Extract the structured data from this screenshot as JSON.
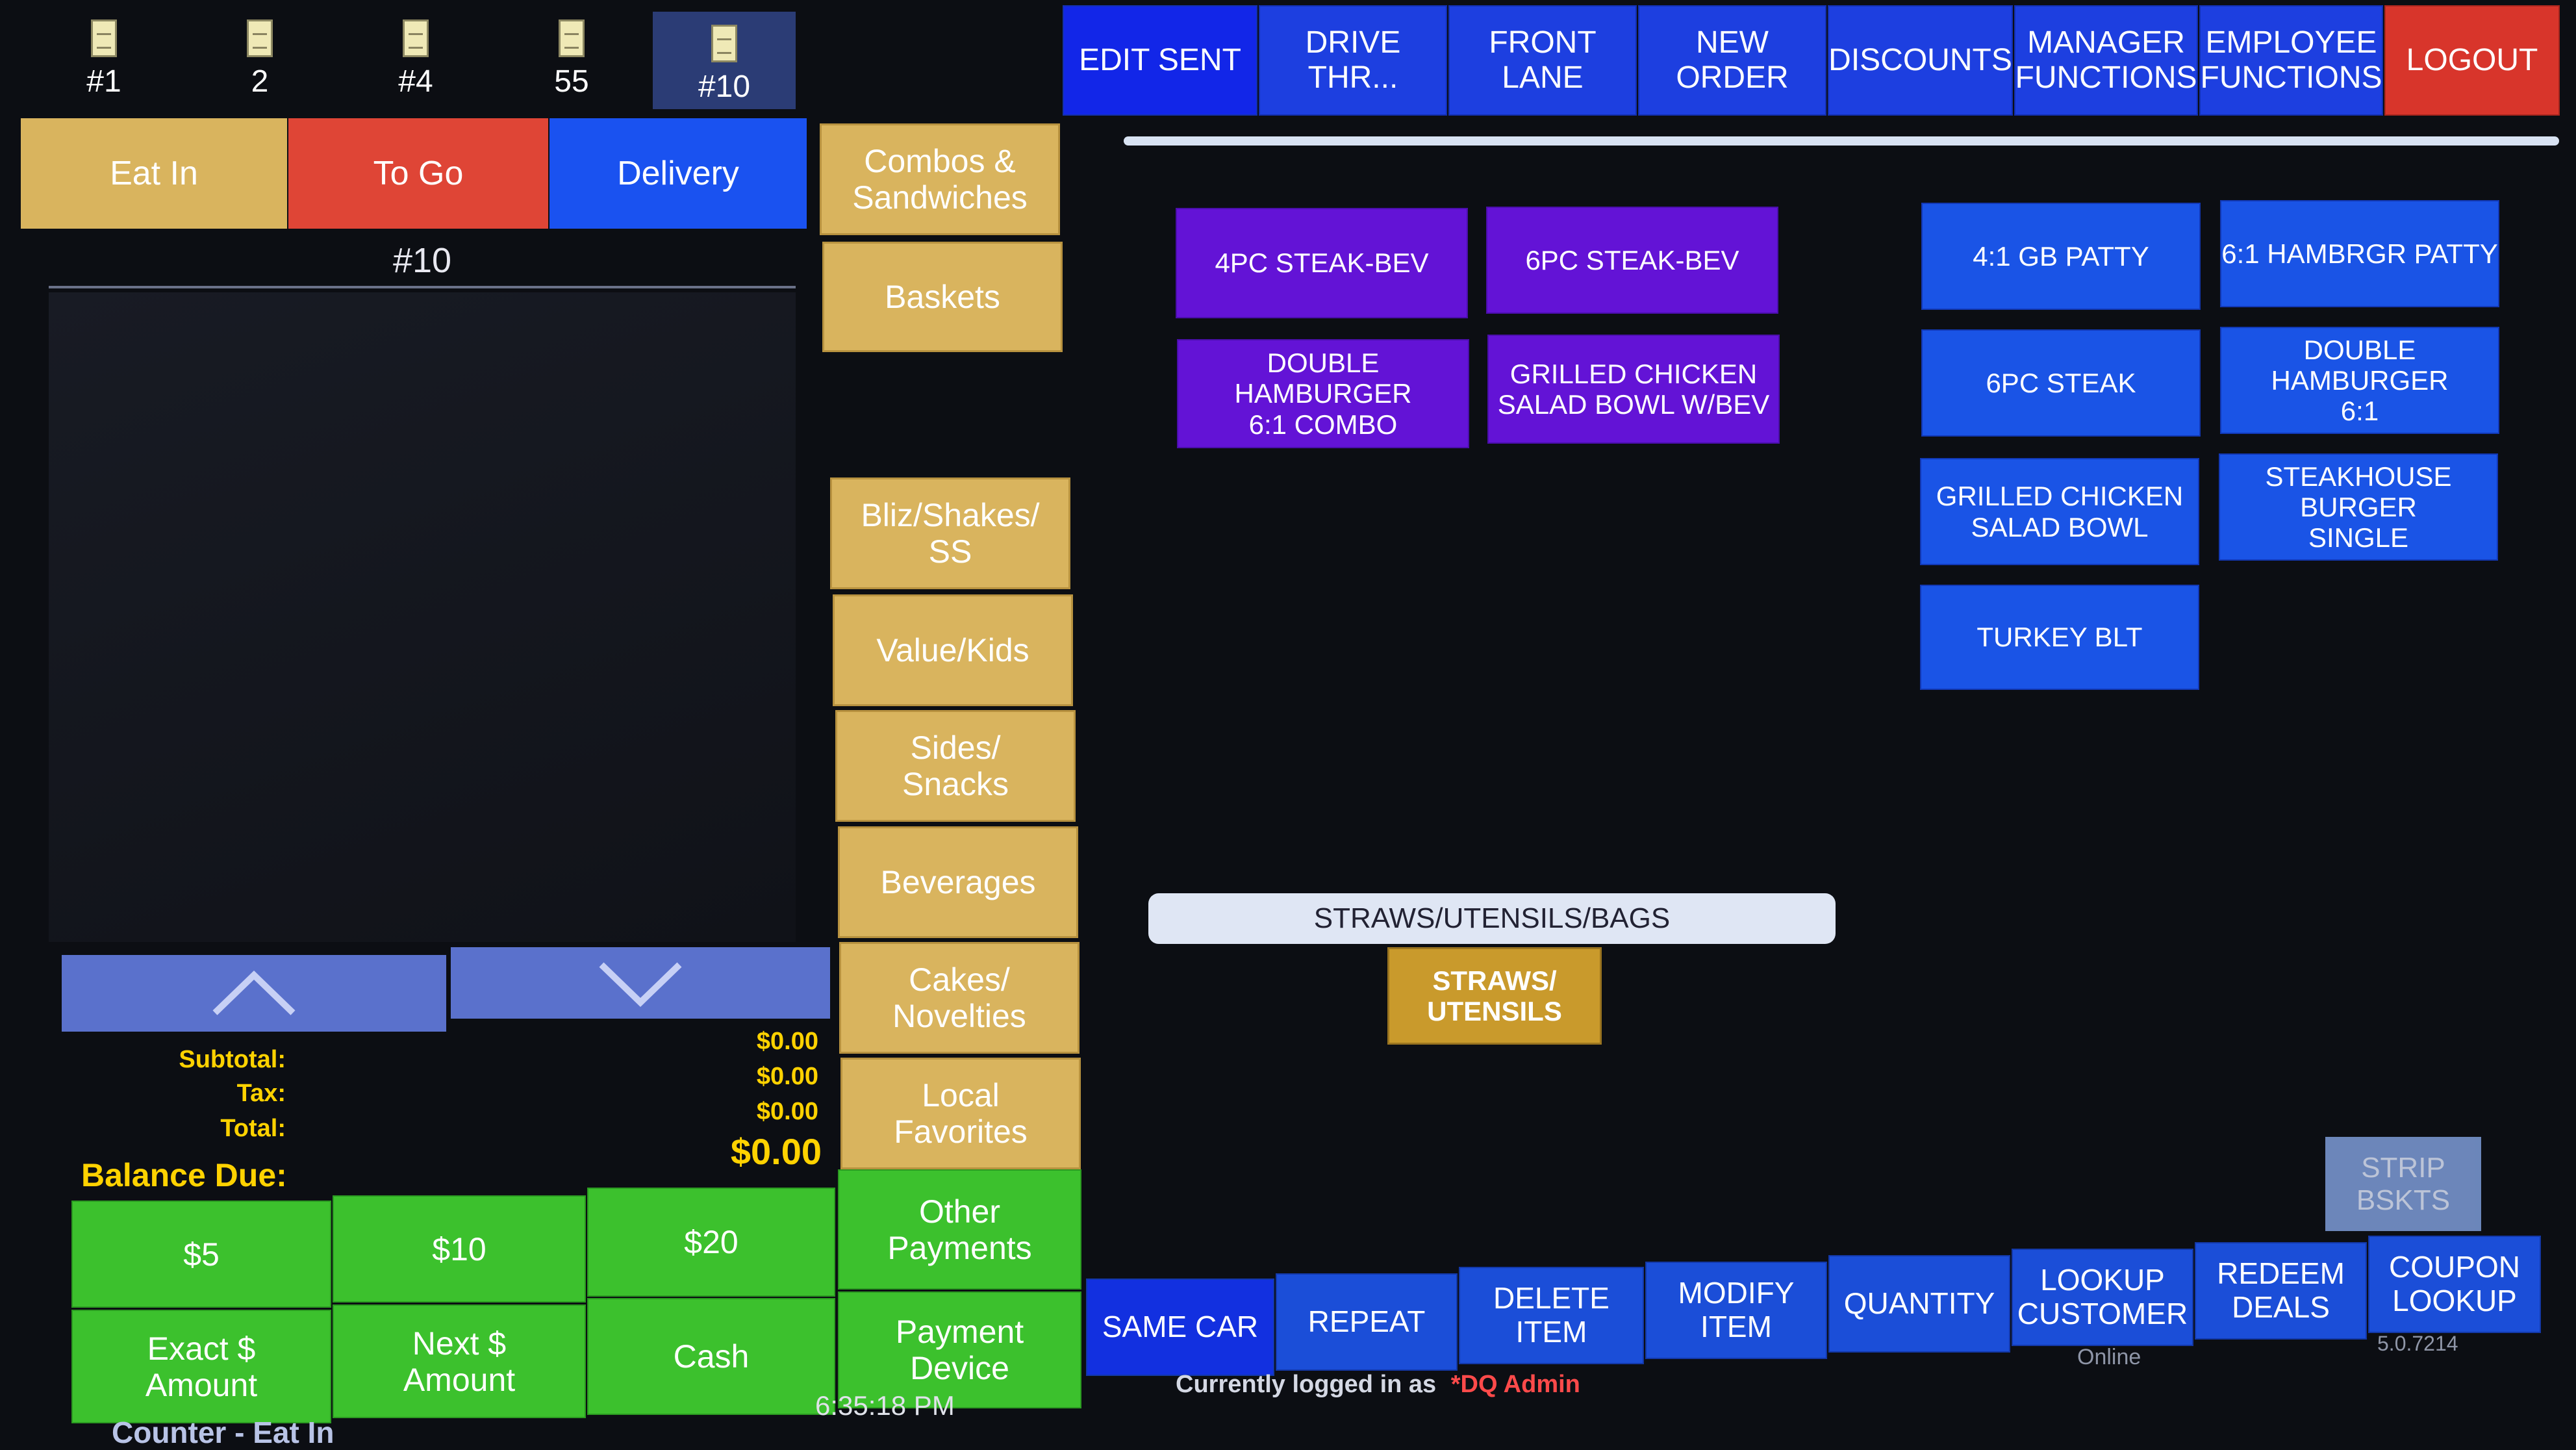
{
  "orders": [
    {
      "label": "#1",
      "selected": false
    },
    {
      "label": "2",
      "selected": false
    },
    {
      "label": "#4",
      "selected": false
    },
    {
      "label": "55",
      "selected": false
    },
    {
      "label": "#10",
      "selected": true
    }
  ],
  "dine_options": {
    "eat_in": "Eat In",
    "to_go": "To Go",
    "delivery": "Delivery"
  },
  "order_panel": {
    "order_number": "#10"
  },
  "categories": [
    "Combos &\nSandwiches",
    "Baskets",
    "Bliz/Shakes/\nSS",
    "Value/Kids",
    "Sides/\nSnacks",
    "Beverages",
    "Cakes/\nNovelties",
    "Local\nFavorites"
  ],
  "top_nav": [
    {
      "label": "EDIT SENT",
      "color": "#1d3fe0"
    },
    {
      "label": "DRIVE\nTHR...",
      "color": "#1d3fe0"
    },
    {
      "label": "FRONT\nLANE",
      "color": "#1d3fe0"
    },
    {
      "label": "NEW\nORDER",
      "color": "#1d3fe0"
    },
    {
      "label": "DISCOUNTS",
      "color": "#1d3fe0"
    },
    {
      "label": "MANAGER\nFUNCTIONS",
      "color": "#1d3fe0"
    },
    {
      "label": "EMPLOYEE\nFUNCTIONS",
      "color": "#1d3fe0"
    },
    {
      "label": "LOGOUT",
      "color": "#d8352b"
    }
  ],
  "combo_items": [
    "4PC STEAK-BEV",
    "6PC STEAK-BEV",
    "DOUBLE HAMBURGER\n6:1 COMBO",
    "GRILLED CHICKEN\nSALAD BOWL W/BEV"
  ],
  "menu_items": [
    "4:1 GB PATTY",
    "6:1 HAMBRGR PATTY",
    "6PC STEAK",
    "DOUBLE HAMBURGER\n6:1",
    "GRILLED CHICKEN\nSALAD BOWL",
    "STEAKHOUSE BURGER\nSINGLE",
    "TURKEY BLT"
  ],
  "straws_section": {
    "header": "STRAWS/UTENSILS/BAGS",
    "button": "STRAWS/\nUTENSILS"
  },
  "strip_button": "STRIP\nBSKTS",
  "totals": {
    "subtotal_label": "Subtotal:",
    "subtotal": "$0.00",
    "tax_label": "Tax:",
    "tax": "$0.00",
    "total_label": "Total:",
    "total": "$0.00",
    "balance_label": "Balance Due:",
    "balance": "$0.00"
  },
  "payments": {
    "five": "$5",
    "ten": "$10",
    "twenty": "$20",
    "other": "Other\nPayments",
    "exact": "Exact $\nAmount",
    "next": "Next $\nAmount",
    "cash": "Cash",
    "device": "Payment\nDevice"
  },
  "bottom_bar": [
    {
      "label": "SAME CAR",
      "color": "#1230e0"
    },
    {
      "label": "REPEAT",
      "color": "#1b4ed8"
    },
    {
      "label": "DELETE\nITEM",
      "color": "#1b4ed8"
    },
    {
      "label": "MODIFY\nITEM",
      "color": "#1b4ed8"
    },
    {
      "label": "QUANTITY",
      "color": "#1b4ed8"
    },
    {
      "label": "LOOKUP\nCUSTOMER",
      "color": "#1b4ed8"
    },
    {
      "label": "REDEEM\nDEALS",
      "color": "#1b4ed8"
    },
    {
      "label": "COUPON\nLOOKUP",
      "color": "#1b4ed8"
    }
  ],
  "status": {
    "time": "6:35:18 PM",
    "logged_in_prefix": "Currently logged in as",
    "user": "*DQ Admin",
    "online": "Online",
    "version": "5.0.7214",
    "mode": "Counter - Eat In"
  },
  "colors": {
    "eat_in": "#d9b45e",
    "to_go": "#df4536",
    "delivery": "#1a52f0",
    "category": "#d9b45e",
    "combo": "#6313d6",
    "item": "#1a54e6",
    "payment": "#3cc12d",
    "logout": "#d8352b"
  }
}
